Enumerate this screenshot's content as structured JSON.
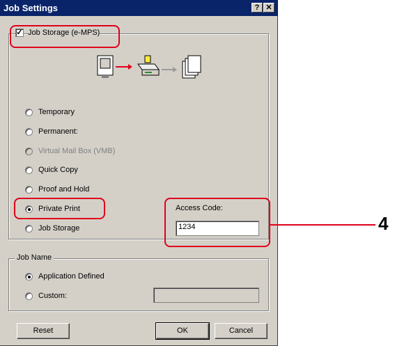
{
  "window": {
    "title": "Job Settings",
    "help_label": "?",
    "close_label": "✕"
  },
  "job_storage": {
    "checkbox_label": "Job Storage (e-MPS)",
    "checked": true,
    "options": [
      {
        "label": "Temporary",
        "selected": false,
        "enabled": true
      },
      {
        "label": "Permanent:",
        "selected": false,
        "enabled": true
      },
      {
        "label": "Virtual Mail Box (VMB)",
        "selected": false,
        "enabled": false
      },
      {
        "label": "Quick Copy",
        "selected": false,
        "enabled": true
      },
      {
        "label": "Proof and Hold",
        "selected": false,
        "enabled": true
      },
      {
        "label": "Private Print",
        "selected": true,
        "enabled": true
      },
      {
        "label": "Job Storage",
        "selected": false,
        "enabled": true
      }
    ],
    "access_code_label": "Access Code:",
    "access_code_value": "1234"
  },
  "job_name": {
    "group_label": "Job Name",
    "options": [
      {
        "label": "Application Defined",
        "selected": true
      },
      {
        "label": "Custom:",
        "selected": false
      }
    ],
    "custom_value": ""
  },
  "buttons": {
    "reset": "Reset",
    "ok": "OK",
    "cancel": "Cancel"
  },
  "callout": {
    "number": "4"
  },
  "colors": {
    "highlight": "#e0001b",
    "titlebar": "#0a246a",
    "dialog_bg": "#d4d0c8"
  }
}
